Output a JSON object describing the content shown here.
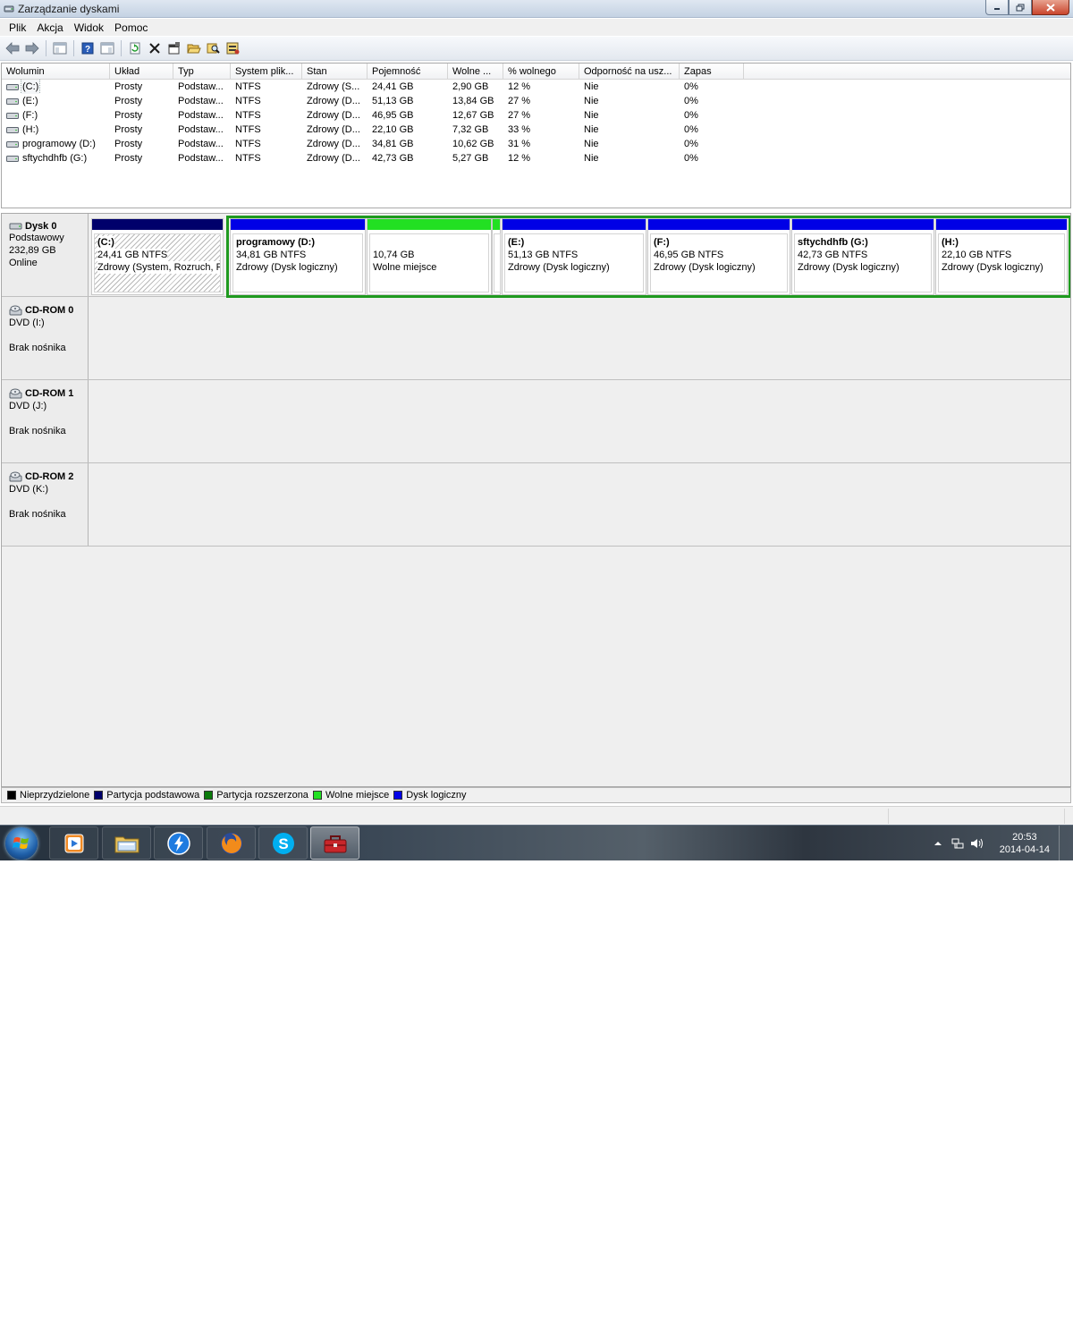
{
  "window": {
    "title": "Zarządzanie dyskami"
  },
  "menu": [
    "Plik",
    "Akcja",
    "Widok",
    "Pomoc"
  ],
  "toolbar_icons": [
    "back-arrow-icon",
    "forward-arrow-icon",
    "console-tree-icon",
    "help-icon",
    "properties-view-icon",
    "refresh-icon",
    "delete-icon",
    "properties-icon",
    "open-icon",
    "explore-icon",
    "settings-icon"
  ],
  "volume_list": {
    "headers": [
      "Wolumin",
      "Układ",
      "Typ",
      "System plik...",
      "Stan",
      "Pojemność",
      "Wolne ...",
      "% wolnego",
      "Odporność na usz...",
      "Zapas"
    ],
    "rows": [
      [
        "(C:)",
        "Prosty",
        "Podstaw...",
        "NTFS",
        "Zdrowy (S...",
        "24,41 GB",
        "2,90 GB",
        "12 %",
        "Nie",
        "0%"
      ],
      [
        "(E:)",
        "Prosty",
        "Podstaw...",
        "NTFS",
        "Zdrowy (D...",
        "51,13 GB",
        "13,84 GB",
        "27 %",
        "Nie",
        "0%"
      ],
      [
        "(F:)",
        "Prosty",
        "Podstaw...",
        "NTFS",
        "Zdrowy (D...",
        "46,95 GB",
        "12,67 GB",
        "27 %",
        "Nie",
        "0%"
      ],
      [
        "(H:)",
        "Prosty",
        "Podstaw...",
        "NTFS",
        "Zdrowy (D...",
        "22,10 GB",
        "7,32 GB",
        "33 %",
        "Nie",
        "0%"
      ],
      [
        "programowy (D:)",
        "Prosty",
        "Podstaw...",
        "NTFS",
        "Zdrowy (D...",
        "34,81 GB",
        "10,62 GB",
        "31 %",
        "Nie",
        "0%"
      ],
      [
        "sftychdhfb (G:)",
        "Prosty",
        "Podstaw...",
        "NTFS",
        "Zdrowy (D...",
        "42,73 GB",
        "5,27 GB",
        "12 %",
        "Nie",
        "0%"
      ]
    ]
  },
  "disks": [
    {
      "name": "Dysk 0",
      "lines": [
        "Podstawowy",
        "232,89 GB",
        "Online"
      ],
      "partitions": [
        {
          "label": "(C:)",
          "size": "24,41 GB NTFS",
          "status": "Zdrowy (System, Rozruch, P",
          "bar_color": "#00006b",
          "hatched": true
        },
        {
          "label": "programowy  (D:)",
          "size": "34,81 GB NTFS",
          "status": "Zdrowy (Dysk logiczny)",
          "bar_color": "#0000e6",
          "hatched": false
        },
        {
          "label": "",
          "size": "10,74 GB",
          "status": "Wolne miejsce",
          "bar_color": "#22e022",
          "hatched": false
        },
        {
          "label": "",
          "size": "",
          "status": "",
          "bar_color": "#22e022",
          "hatched": false
        },
        {
          "label": "(E:)",
          "size": "51,13 GB NTFS",
          "status": "Zdrowy (Dysk logiczny)",
          "bar_color": "#0000e6",
          "hatched": false
        },
        {
          "label": "(F:)",
          "size": "46,95 GB NTFS",
          "status": "Zdrowy (Dysk logiczny)",
          "bar_color": "#0000e6",
          "hatched": false
        },
        {
          "label": "sftychdhfb  (G:)",
          "size": "42,73 GB NTFS",
          "status": "Zdrowy (Dysk logiczny)",
          "bar_color": "#0000e6",
          "hatched": false
        },
        {
          "label": "(H:)",
          "size": "22,10 GB NTFS",
          "status": "Zdrowy (Dysk logiczny)",
          "bar_color": "#0000e6",
          "hatched": false
        }
      ]
    },
    {
      "name": "CD-ROM 0",
      "lines": [
        "DVD (I:)",
        "",
        "Brak nośnika"
      ]
    },
    {
      "name": "CD-ROM 1",
      "lines": [
        "DVD (J:)",
        "",
        "Brak nośnika"
      ]
    },
    {
      "name": "CD-ROM 2",
      "lines": [
        "DVD (K:)",
        "",
        "Brak nośnika"
      ]
    }
  ],
  "legend": [
    {
      "label": "Nieprzydzielone",
      "color": "#000000"
    },
    {
      "label": "Partycja podstawowa",
      "color": "#00006b"
    },
    {
      "label": "Partycja rozszerzona",
      "color": "#0a7a0a"
    },
    {
      "label": "Wolne miejsce",
      "color": "#22e022"
    },
    {
      "label": "Dysk logiczny",
      "color": "#0000e6"
    }
  ],
  "taskbar": {
    "apps": [
      "media-player-icon",
      "file-explorer-icon",
      "thunderbolt-app-icon",
      "firefox-icon",
      "skype-icon",
      "toolbox-icon"
    ],
    "clock": {
      "time": "20:53",
      "date": "2014-04-14"
    }
  }
}
